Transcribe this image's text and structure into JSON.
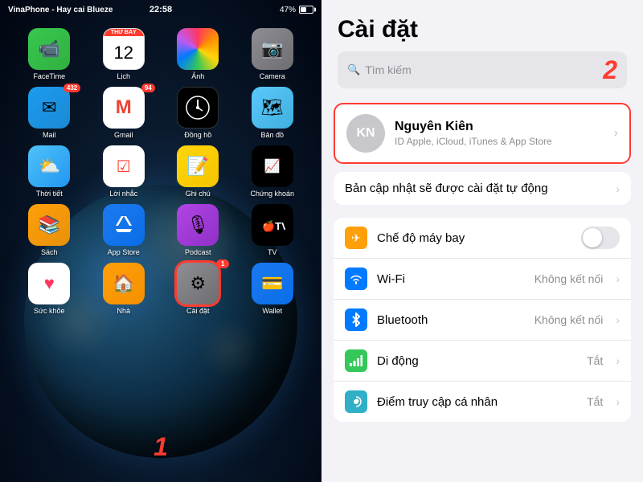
{
  "phone": {
    "carrier": "VinaPhone - Hay cai Blueze",
    "time": "22:58",
    "battery": "47%",
    "apps": {
      "row1": [
        {
          "id": "facetime",
          "label": "FaceTime",
          "icon": "📹",
          "iconClass": "icon-facetime",
          "badge": null
        },
        {
          "id": "calendar",
          "label": "Lịch",
          "icon": "calendar",
          "iconClass": "icon-calendar",
          "badge": null
        },
        {
          "id": "photos",
          "label": "Ảnh",
          "icon": "🌸",
          "iconClass": "icon-photos",
          "badge": null
        },
        {
          "id": "camera",
          "label": "Camera",
          "icon": "📷",
          "iconClass": "icon-camera",
          "badge": null
        }
      ],
      "row2": [
        {
          "id": "mail",
          "label": "Mail",
          "icon": "✉",
          "iconClass": "icon-mail",
          "badge": "432"
        },
        {
          "id": "gmail",
          "label": "Gmail",
          "icon": "M",
          "iconClass": "icon-gmail",
          "badge": "94"
        },
        {
          "id": "clock",
          "label": "Đồng hồ",
          "icon": "🕙",
          "iconClass": "icon-clock",
          "badge": null
        },
        {
          "id": "maps",
          "label": "Bản đồ",
          "icon": "🗺",
          "iconClass": "icon-maps",
          "badge": null
        }
      ],
      "row3": [
        {
          "id": "weather",
          "label": "Thời tiết",
          "icon": "⛅",
          "iconClass": "icon-weather",
          "badge": null
        },
        {
          "id": "reminders",
          "label": "Lời nhắc",
          "icon": "📋",
          "iconClass": "icon-reminders",
          "badge": null
        },
        {
          "id": "notes",
          "label": "Ghi chú",
          "icon": "📝",
          "iconClass": "icon-notes",
          "badge": null
        },
        {
          "id": "stocks",
          "label": "Chứng khoán",
          "icon": "📈",
          "iconClass": "icon-stocks",
          "badge": null
        }
      ],
      "row4": [
        {
          "id": "books",
          "label": "Sách",
          "icon": "📚",
          "iconClass": "icon-books",
          "badge": null
        },
        {
          "id": "appstore",
          "label": "App Store",
          "icon": "A",
          "iconClass": "icon-appstore",
          "badge": null
        },
        {
          "id": "podcasts",
          "label": "Podcast",
          "icon": "🎙",
          "iconClass": "icon-podcasts",
          "badge": null
        },
        {
          "id": "appletv",
          "label": "TV",
          "icon": "tv",
          "iconClass": "icon-appletv",
          "badge": null
        }
      ],
      "row5": [
        {
          "id": "health",
          "label": "Sức khỏe",
          "icon": "❤",
          "iconClass": "icon-health",
          "badge": null
        },
        {
          "id": "home",
          "label": "Nhà",
          "icon": "🏠",
          "iconClass": "icon-home",
          "badge": null
        },
        {
          "id": "settings",
          "label": "Cài đặt",
          "icon": "⚙",
          "iconClass": "icon-settings",
          "badge": "1",
          "highlighted": true
        },
        {
          "id": "wallet",
          "label": "Wallet",
          "icon": "💳",
          "iconClass": "icon-wallet",
          "badge": null
        }
      ]
    },
    "step1": "1"
  },
  "settings": {
    "title": "Cài đặt",
    "search_placeholder": "Tìm kiếm",
    "step2": "2",
    "profile": {
      "initials": "KN",
      "name": "Nguyên Kiên",
      "subtitle": "ID Apple, iCloud, iTunes & App Store"
    },
    "update_row": "Bản cập nhật sẽ được cài đặt tự động",
    "rows": [
      {
        "id": "airplane",
        "label": "Chế độ máy bay",
        "value": null,
        "toggle": true,
        "toggleOn": false,
        "iconClass": "icon-airplane",
        "icon": "✈"
      },
      {
        "id": "wifi",
        "label": "Wi-Fi",
        "value": "Không kết nối",
        "toggle": false,
        "iconClass": "icon-wifi",
        "icon": "📶"
      },
      {
        "id": "bluetooth",
        "label": "Bluetooth",
        "value": "Không kết nối",
        "toggle": false,
        "iconClass": "icon-bluetooth",
        "icon": "⬡"
      },
      {
        "id": "cellular",
        "label": "Di động",
        "value": "Tắt",
        "toggle": false,
        "iconClass": "icon-cellular",
        "icon": "📡"
      },
      {
        "id": "focus",
        "label": "Điểm truy cập cá nhân",
        "value": "Tắt",
        "toggle": false,
        "iconClass": "icon-focus",
        "icon": "⊕"
      }
    ]
  }
}
